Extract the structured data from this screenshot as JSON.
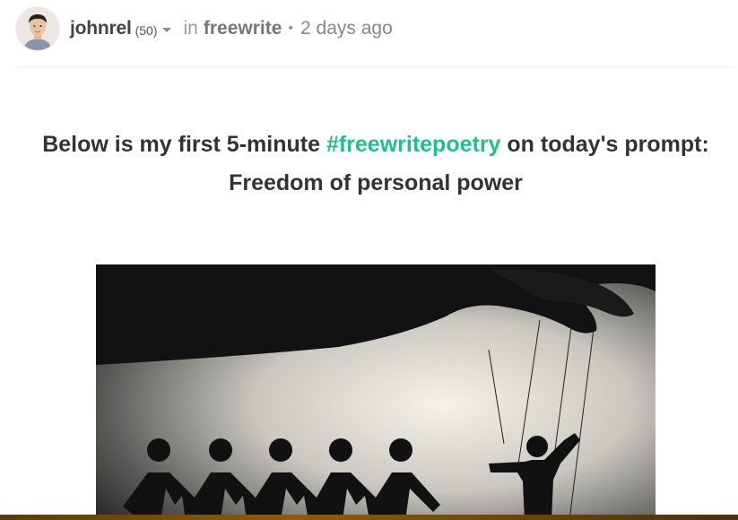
{
  "post": {
    "author": "johnrel",
    "reputation": "(50)",
    "in_label": "in",
    "community": "freewrite",
    "separator": "•",
    "time_ago": "2 days ago"
  },
  "body": {
    "title_before": "Below is my first 5-minute ",
    "hashtag": "#freewritepoetry",
    "title_after": " on today's prompt:",
    "title_line2": "Freedom of personal power"
  },
  "icons": {
    "caret": "chevron-down-icon",
    "avatar": "avatar"
  },
  "colors": {
    "hashtag": "#1fbf8f",
    "text": "#333333",
    "muted": "#999999"
  }
}
